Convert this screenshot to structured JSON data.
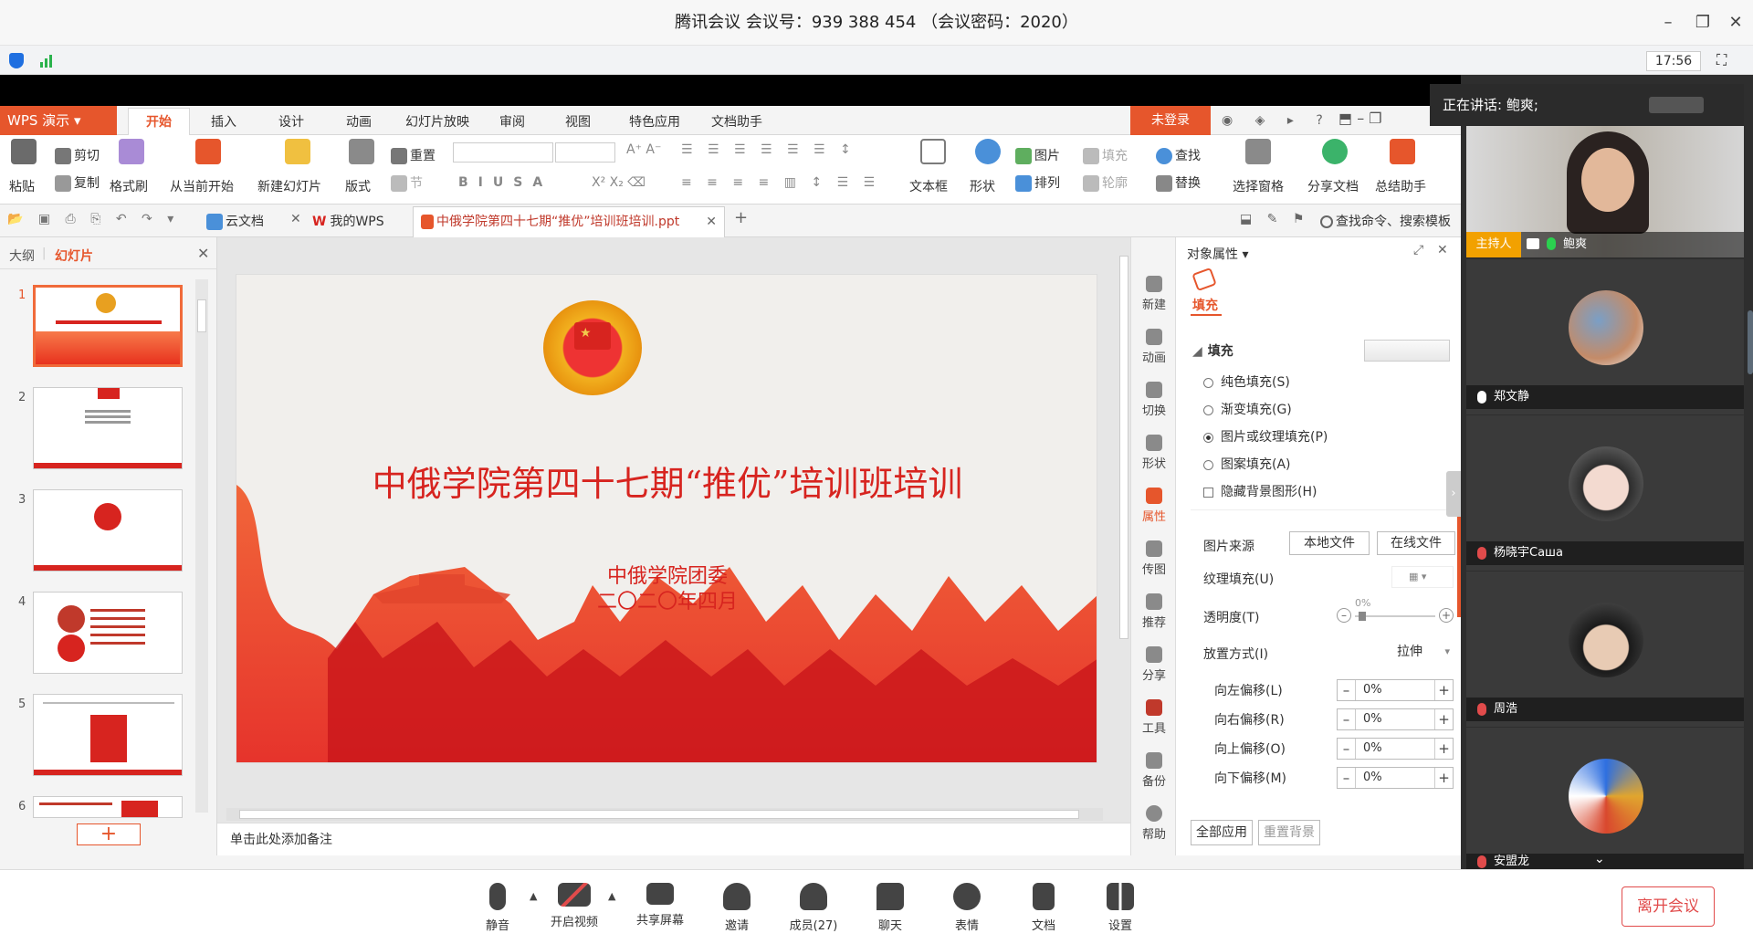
{
  "meeting": {
    "title": "腾讯会议 会议号：939 388 454 （会议密码：2020）",
    "time": "17:56",
    "speaking_label": "正在讲话: 鲍爽;"
  },
  "wps": {
    "logo": "WPS 演示",
    "tabs": [
      "开始",
      "插入",
      "设计",
      "动画",
      "幻灯片放映",
      "审阅",
      "视图",
      "特色应用",
      "文档助手"
    ],
    "login": "未登录",
    "ribbon": {
      "paste": "粘贴",
      "cut": "剪切",
      "copy": "复制",
      "format_brush": "格式刷",
      "from_current": "从当前开始",
      "new_slide": "新建幻灯片",
      "layout": "版式",
      "reset": "重置",
      "section": "节",
      "textbox": "文本框",
      "shape": "形状",
      "picture": "图片",
      "fill": "填充",
      "arrange": "排列",
      "outline": "轮廓",
      "find": "查找",
      "replace": "替换",
      "select_pane": "选择窗格",
      "share_doc": "分享文档",
      "summary_helper": "总结助手"
    },
    "doc_tabs": {
      "cloud": "云文档",
      "mywps": "我的WPS",
      "active": "中俄学院第四十七期“推优”培训班培训.ppt",
      "search": "查找命令、搜索模板"
    },
    "left_panel": {
      "outline_tab": "大纲",
      "slides_tab": "幻灯片",
      "slide_numbers": [
        "1",
        "2",
        "3",
        "4",
        "5",
        "6"
      ]
    },
    "slide": {
      "title": "中俄学院第四十七期“推优”培训班培训",
      "org": "中俄学院团委",
      "date": "二〇二〇年四月"
    },
    "notes_placeholder": "单击此处添加备注",
    "icon_strip": [
      "新建",
      "动画",
      "切换",
      "形状",
      "属性",
      "传图",
      "推荐",
      "分享",
      "工具",
      "备份",
      "帮助"
    ],
    "properties": {
      "header": "对象属性",
      "fill_tab": "填充",
      "fill_section": "填充",
      "solid": "纯色填充(S)",
      "gradient": "渐变填充(G)",
      "picture_texture": "图片或纹理填充(P)",
      "pattern": "图案填充(A)",
      "hide_bg": "隐藏背景图形(H)",
      "pic_source": "图片来源",
      "local_file": "本地文件",
      "online_file": "在线文件",
      "texture_fill": "纹理填充(U)",
      "transparency": "透明度(T)",
      "transparency_value": "0%",
      "placement": "放置方式(I)",
      "placement_value": "拉伸",
      "offset_left": "向左偏移(L)",
      "offset_right": "向右偏移(R)",
      "offset_up": "向上偏移(O)",
      "offset_down": "向下偏移(M)",
      "offset_value": "0%",
      "apply_all": "全部应用",
      "reset_bg": "重置背景"
    }
  },
  "participants": [
    {
      "name": "鲍爽",
      "host_badge": "主持人"
    },
    {
      "name": "郑文静"
    },
    {
      "name": "杨晓宇Caшa"
    },
    {
      "name": "周浩"
    },
    {
      "name": "安盟龙"
    }
  ],
  "toolbar": {
    "mute": "静音",
    "video": "开启视频",
    "share": "共享屏幕",
    "invite": "邀请",
    "members": "成员(27)",
    "chat": "聊天",
    "emoji": "表情",
    "docs": "文档",
    "settings": "设置",
    "leave": "离开会议"
  },
  "colors": {
    "wps_accent": "#e6562c",
    "slide_red": "#d7241f",
    "leave_red": "#e14b4b",
    "host_badge": "#f2a100"
  }
}
